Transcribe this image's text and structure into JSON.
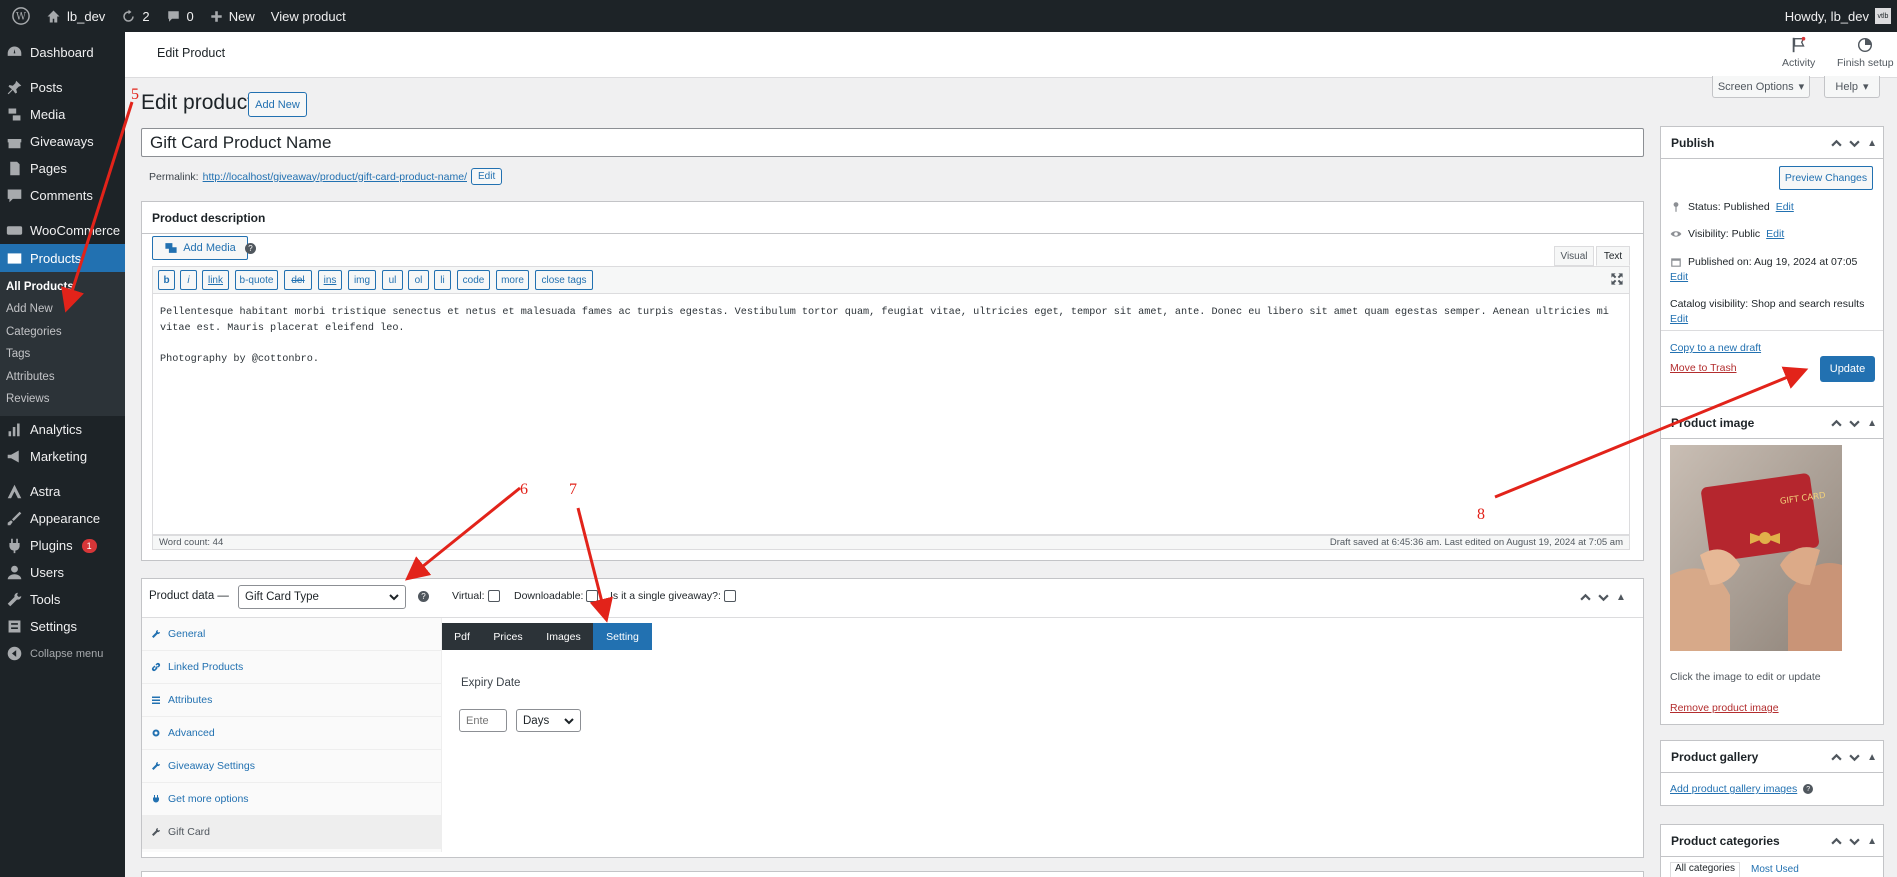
{
  "adminbar": {
    "site": "lb_dev",
    "updates": "2",
    "comments": "0",
    "new": "New",
    "view": "View product",
    "howdy": "Howdy, lb_dev",
    "avatar": "vtlb"
  },
  "sidebar": {
    "items": [
      {
        "label": "Dashboard",
        "icon": "dashboard-icon"
      },
      {
        "label": "Posts",
        "icon": "pushpin-icon"
      },
      {
        "label": "Media",
        "icon": "media-icon"
      },
      {
        "label": "Giveaways",
        "icon": "gift-icon"
      },
      {
        "label": "Pages",
        "icon": "page-icon"
      },
      {
        "label": "Comments",
        "icon": "comment-icon"
      },
      {
        "label": "WooCommerce",
        "icon": "woo-icon"
      },
      {
        "label": "Products",
        "icon": "products-icon"
      }
    ],
    "sub": [
      "All Products",
      "Add New",
      "Categories",
      "Tags",
      "Attributes",
      "Reviews"
    ],
    "items2": [
      {
        "label": "Analytics",
        "icon": "bar-chart-icon"
      },
      {
        "label": "Marketing",
        "icon": "megaphone-icon"
      },
      {
        "label": "Astra",
        "icon": "astra-icon"
      },
      {
        "label": "Appearance",
        "icon": "brush-icon"
      },
      {
        "label": "Plugins",
        "icon": "plug-icon",
        "badge": "1"
      },
      {
        "label": "Users",
        "icon": "user-icon"
      },
      {
        "label": "Tools",
        "icon": "wrench-icon"
      },
      {
        "label": "Settings",
        "icon": "settings-icon"
      },
      {
        "label": "Collapse menu",
        "icon": "collapse-icon"
      }
    ]
  },
  "top": {
    "title": "Edit Product",
    "activity": "Activity",
    "finish": "Finish setup",
    "screen_options": "Screen Options",
    "help": "Help"
  },
  "page": {
    "heading": "Edit product",
    "add_new": "Add New",
    "title_value": "Gift Card Product Name",
    "permalink_label": "Permalink:",
    "permalink_url": "http://localhost/giveaway/product/gift-card-product-name/",
    "permalink_edit": "Edit"
  },
  "desc": {
    "header": "Product description",
    "add_media": "Add Media",
    "visual": "Visual",
    "text": "Text",
    "quicktags": [
      "b",
      "i",
      "link",
      "b-quote",
      "del",
      "ins",
      "img",
      "ul",
      "ol",
      "li",
      "code",
      "more",
      "close tags"
    ],
    "line1": "Pellentesque habitant morbi tristique senectus et netus et malesuada fames ac turpis egestas. Vestibulum tortor quam, feugiat vitae, ultricies eget, tempor sit amet, ante. Donec eu libero sit amet quam egestas semper. Aenean ultricies mi vitae est. Mauris placerat eleifend leo.",
    "line2": "Photography by @cottonbro.",
    "word_count": "Word count: 44",
    "draft": "Draft saved at 6:45:36 am. Last edited on August 19, 2024 at 7:05 am"
  },
  "pdata": {
    "label": "Product data —",
    "type": "Gift Card Type",
    "virtual": "Virtual:",
    "downloadable": "Downloadable:",
    "single": "Is it a single giveaway?:",
    "side": [
      {
        "label": "General",
        "icon": "wrench-icon"
      },
      {
        "label": "Linked Products",
        "icon": "link-icon"
      },
      {
        "label": "Attributes",
        "icon": "list-icon"
      },
      {
        "label": "Advanced",
        "icon": "gear-icon"
      },
      {
        "label": "Giveaway Settings",
        "icon": "wrench-icon"
      },
      {
        "label": "Get more options",
        "icon": "plugin-icon"
      },
      {
        "label": "Gift Card",
        "icon": "wrench-icon"
      }
    ],
    "tabs": [
      "Pdf",
      "Prices",
      "Images",
      "Setting"
    ],
    "expiry_label": "Expiry Date",
    "expiry_placeholder": "Ente",
    "unit": "Days"
  },
  "publish": {
    "header": "Publish",
    "preview": "Preview Changes",
    "status": "Status: Published",
    "visibility": "Visibility: Public",
    "published_on": "Published on: Aug 19, 2024 at 07:05",
    "catalog": "Catalog visibility: Shop and search results",
    "edit": "Edit",
    "copy": "Copy to a new draft",
    "trash": "Move to Trash",
    "update": "Update"
  },
  "pimage": {
    "header": "Product image",
    "card_text": "GIFT CARD",
    "hint": "Click the image to edit or update",
    "remove": "Remove product image"
  },
  "gallery": {
    "header": "Product gallery",
    "add": "Add product gallery images"
  },
  "cats": {
    "header": "Product categories",
    "all": "All categories",
    "most": "Most Used"
  },
  "annotations": [
    "5",
    "6",
    "7",
    "8"
  ]
}
